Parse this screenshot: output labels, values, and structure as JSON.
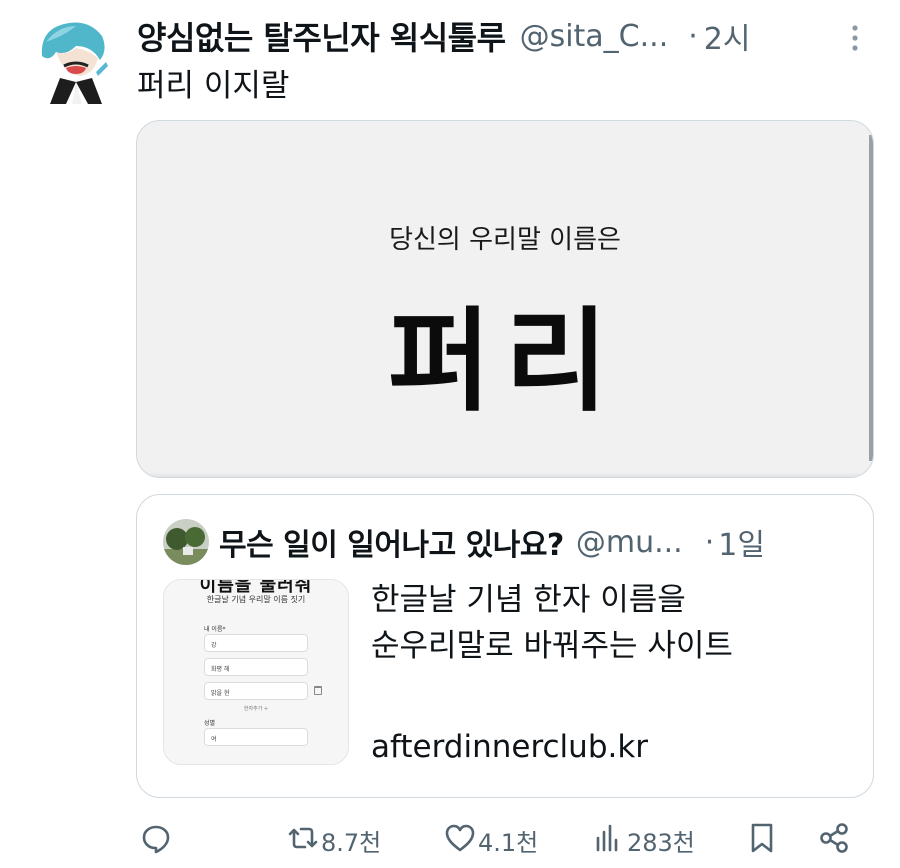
{
  "tweet": {
    "author_name": "양심없는 탈주닌자 왹식툴루",
    "author_handle": "@sita_C...",
    "dot": "·",
    "time": "2시",
    "text": "퍼리 이지랄"
  },
  "media": {
    "subtitle": "당신의 우리말 이름은",
    "name": "퍼리"
  },
  "quote": {
    "author_name": "무슨 일이 일어나고 있나요?",
    "author_handle": "@mu...",
    "dot": "·",
    "time": "1일",
    "text_lines": [
      "한글날 기념 한자 이름을",
      "순우리말로 바꿔주는 사이트"
    ],
    "url": "afterdinnerclub.kr",
    "thumbnail": {
      "title": "이름을 불러줘",
      "subtitle": "한글날 기념 우리말 이름 짓기",
      "label_name": "내 이름*",
      "fields": [
        "강",
        "화평 해",
        "밝을 현"
      ],
      "add_label": "한자추가 +",
      "label_gender": "성별",
      "gender_value": "여"
    }
  },
  "actions": {
    "retweets": "8.7천",
    "likes": "4.1천",
    "views": "283천"
  },
  "icons": [
    "more-icon",
    "reply-icon",
    "retweet-icon",
    "like-icon",
    "views-icon",
    "bookmark-icon",
    "share-icon",
    "trash-icon"
  ],
  "colors": {
    "text": "#0f1419",
    "secondary": "#536471",
    "border": "#cfd9de"
  }
}
